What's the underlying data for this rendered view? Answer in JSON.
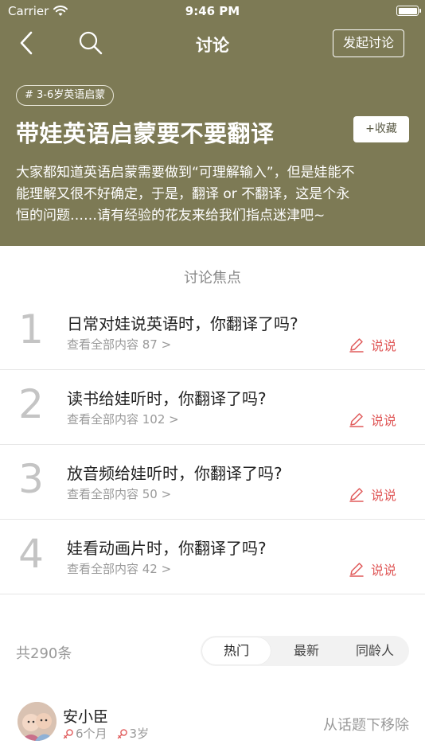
{
  "status_bar": {
    "carrier": "Carrier",
    "time": "9:46 PM"
  },
  "nav": {
    "title": "讨论",
    "start_button": "发起讨论"
  },
  "topic": {
    "tag": "# 3-6岁英语启蒙",
    "title": "带娃英语启蒙要不要翻译",
    "collect_button": "+收藏",
    "description_lines": [
      "大家都知道英语启蒙需要做到“可理解输入”，但是娃能不",
      "能理解又很不好确定，于是，翻译 or 不翻译，这是个永",
      "恒的问题……请有经验的花友来给我们指点迷津吧~"
    ]
  },
  "focus": {
    "heading": "讨论焦点",
    "items": [
      {
        "num": "1",
        "question": "日常对娃说英语时，你翻译了吗?",
        "view_all": "查看全部内容 87 >",
        "say": "说说"
      },
      {
        "num": "2",
        "question": "读书给娃听时，你翻译了吗?",
        "view_all": "查看全部内容 102 >",
        "say": "说说"
      },
      {
        "num": "3",
        "question": "放音频给娃听时，你翻译了吗?",
        "view_all": "查看全部内容 50 >",
        "say": "说说"
      },
      {
        "num": "4",
        "question": "娃看动画片时，你翻译了吗?",
        "view_all": "查看全部内容 42 >",
        "say": "说说"
      }
    ]
  },
  "list_controls": {
    "total": "共290条",
    "tabs": [
      "热门",
      "最新",
      "同龄人"
    ],
    "active_tab": "热门"
  },
  "post": {
    "name": "安小臣",
    "child1_age": "6个月",
    "child2_age": "3岁",
    "remove": "从话题下移除"
  },
  "colors": {
    "header_bg": "#7d7a55",
    "accent_red": "#e05a5a",
    "muted_text": "#999999"
  },
  "icons": [
    "wifi-icon",
    "battery-icon",
    "back-chevron-icon",
    "search-icon",
    "pencil-icon",
    "female-icon"
  ]
}
